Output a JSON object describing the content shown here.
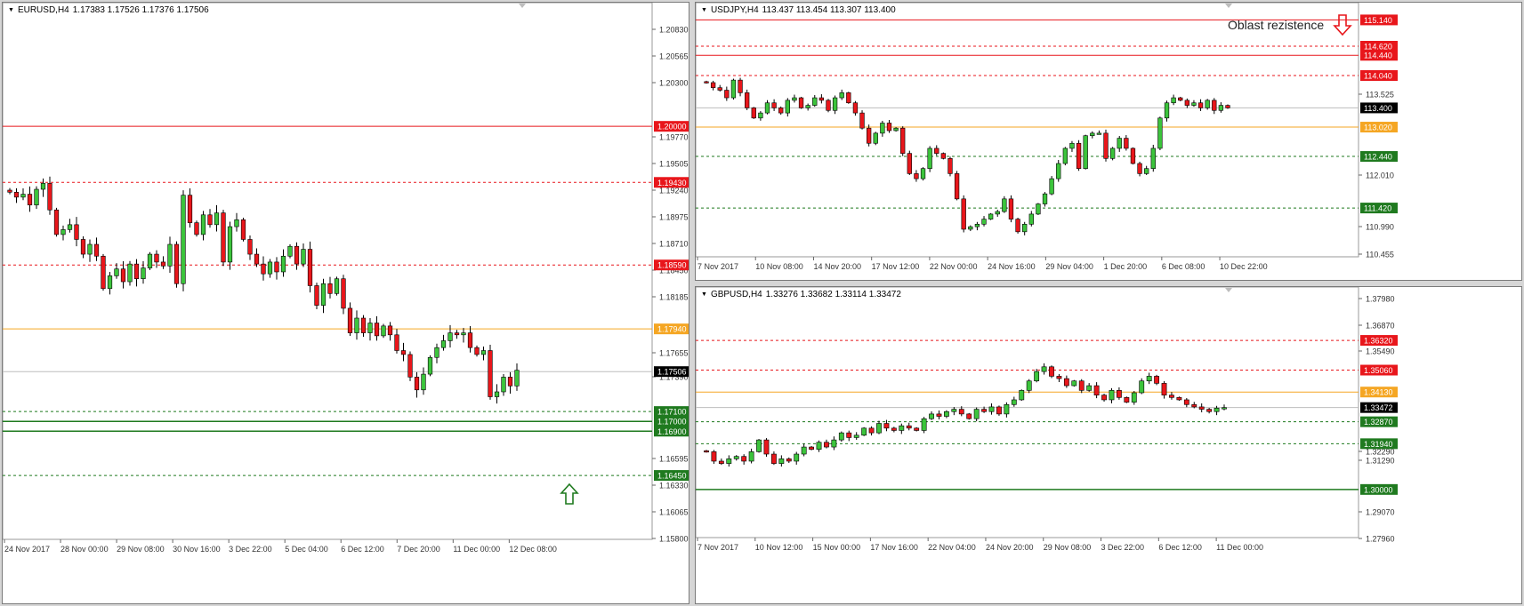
{
  "colors": {
    "background": "#ffffff",
    "resistance": "#e8161b",
    "support": "#1f7a1f",
    "pivot": "#f5a623",
    "current": "#000000",
    "bull": "#3cc43c",
    "bear": "#e8161b",
    "axis_text": "#333333"
  },
  "panels": [
    {
      "id": "eurusd",
      "header": {
        "symbol": "EURUSD,H4",
        "ohlc": "1.17383 1.17526 1.17376 1.17506"
      },
      "y_range": [
        1.158,
        1.21095
      ],
      "price_ticks": [
        "1.20830",
        "1.20565",
        "1.20300",
        "1.19770",
        "1.19505",
        "1.19240",
        "1.18975",
        "1.18710",
        "1.18450",
        "1.18185",
        "1.17655",
        "1.17390",
        "1.16595",
        "1.16330",
        "1.16065",
        "1.15800"
      ],
      "time_labels": [
        "24 Nov 2017",
        "28 Nov 00:00",
        "29 Nov 08:00",
        "30 Nov 16:00",
        "3 Dec 22:00",
        "5 Dec 04:00",
        "6 Dec 12:00",
        "7 Dec 20:00",
        "11 Dec 00:00",
        "12 Dec 08:00"
      ],
      "levels": [
        {
          "price": 1.2,
          "label": "1.20000",
          "kind": "resistance",
          "style": "solid"
        },
        {
          "price": 1.1943,
          "label": "1.19430",
          "kind": "resistance",
          "style": "dashed"
        },
        {
          "price": 1.1859,
          "label": "1.18590",
          "kind": "resistance",
          "style": "dashed"
        },
        {
          "price": 1.1794,
          "label": "1.17940",
          "kind": "pivot",
          "style": "solid"
        },
        {
          "price": 1.17506,
          "label": "1.17506",
          "kind": "current",
          "style": "solid"
        },
        {
          "price": 1.171,
          "label": "1.17100",
          "kind": "support",
          "style": "dashed"
        },
        {
          "price": 1.17,
          "label": "1.17000",
          "kind": "support",
          "style": "solid"
        },
        {
          "price": 1.169,
          "label": "1.16900",
          "kind": "support",
          "style": "solid"
        },
        {
          "price": 1.1645,
          "label": "1.16450",
          "kind": "support",
          "style": "dashed"
        }
      ],
      "candles": [
        1.1933,
        1.1928,
        1.1931,
        1.192,
        1.1936,
        1.1942,
        1.1915,
        1.189,
        1.1895,
        1.19,
        1.1885,
        1.187,
        1.188,
        1.1868,
        1.1835,
        1.1848,
        1.1855,
        1.1842,
        1.186,
        1.1845,
        1.1856,
        1.187,
        1.1862,
        1.1858,
        1.188,
        1.184,
        1.193,
        1.1902,
        1.189,
        1.191,
        1.19,
        1.1912,
        1.1862,
        1.1898,
        1.1905,
        1.1885,
        1.187,
        1.186,
        1.185,
        1.1862,
        1.1852,
        1.1868,
        1.1878,
        1.186,
        1.1875,
        1.1838,
        1.1818,
        1.184,
        1.183,
        1.1845,
        1.1815,
        1.179,
        1.1805,
        1.179,
        1.18,
        1.1787,
        1.1797,
        1.1788,
        1.1772,
        1.1768,
        1.1745,
        1.1732,
        1.1748,
        1.1765,
        1.1775,
        1.1782,
        1.179,
        1.1788,
        1.179,
        1.1775,
        1.1768,
        1.1772,
        1.1725,
        1.173,
        1.1745,
        1.1736,
        1.1752
      ]
    },
    {
      "id": "usdjpy",
      "header": {
        "symbol": "USDJPY,H4",
        "ohlc": "113.437 113.454 113.307 113.400"
      },
      "y_range": [
        110.455,
        115.2
      ],
      "price_ticks": [
        "113.525",
        "112.010",
        "110.990",
        "110.455"
      ],
      "time_labels": [
        "7 Nov 2017",
        "10 Nov 08:00",
        "14 Nov 20:00",
        "17 Nov 12:00",
        "22 Nov 00:00",
        "24 Nov 16:00",
        "29 Nov 04:00",
        "1 Dec 20:00",
        "6 Dec 08:00",
        "10 Dec 22:00"
      ],
      "levels": [
        {
          "price": 115.14,
          "label": "115.140",
          "kind": "resistance",
          "style": "solid"
        },
        {
          "price": 114.62,
          "label": "114.620",
          "kind": "resistance",
          "style": "dashed"
        },
        {
          "price": 114.44,
          "label": "114.440",
          "kind": "resistance",
          "style": "solid"
        },
        {
          "price": 114.04,
          "label": "114.040",
          "kind": "resistance",
          "style": "dashed"
        },
        {
          "price": 113.4,
          "label": "113.400",
          "kind": "current",
          "style": "solid"
        },
        {
          "price": 113.02,
          "label": "113.020",
          "kind": "pivot",
          "style": "solid"
        },
        {
          "price": 112.44,
          "label": "112.440",
          "kind": "support",
          "style": "dashed"
        },
        {
          "price": 111.42,
          "label": "111.420",
          "kind": "support",
          "style": "dashed"
        }
      ],
      "annotation": "Oblast rezistence",
      "candles": [
        113.9,
        113.8,
        113.75,
        113.6,
        113.95,
        113.7,
        113.4,
        113.2,
        113.3,
        113.5,
        113.4,
        113.3,
        113.55,
        113.6,
        113.4,
        113.45,
        113.6,
        113.55,
        113.35,
        113.6,
        113.7,
        113.5,
        113.3,
        113.0,
        112.7,
        112.9,
        113.1,
        112.95,
        113.0,
        112.5,
        112.1,
        112.0,
        112.2,
        112.6,
        112.5,
        112.4,
        112.1,
        111.6,
        111.0,
        111.05,
        111.1,
        111.2,
        111.3,
        111.35,
        111.6,
        111.2,
        110.95,
        111.1,
        111.3,
        111.5,
        111.7,
        112.0,
        112.3,
        112.6,
        112.7,
        112.2,
        112.85,
        112.9,
        112.9,
        112.4,
        112.6,
        112.8,
        112.6,
        112.3,
        112.1,
        112.2,
        112.6,
        113.2,
        113.5,
        113.6,
        113.55,
        113.45,
        113.5,
        113.4,
        113.55,
        113.35,
        113.45,
        113.4
      ]
    },
    {
      "id": "gbpusd",
      "header": {
        "symbol": "GBPUSD,H4",
        "ohlc": "1.33276 1.33682 1.33114 1.33472"
      },
      "y_range": [
        1.2796,
        1.3798
      ],
      "price_ticks": [
        "1.37980",
        "1.36870",
        "1.35490",
        "1.32290",
        "1.31290",
        "1.29070",
        "1.27960"
      ],
      "time_labels": [
        "7 Nov 2017",
        "10 Nov 12:00",
        "15 Nov 00:00",
        "17 Nov 16:00",
        "22 Nov 04:00",
        "24 Nov 20:00",
        "29 Nov 08:00",
        "3 Dec 22:00",
        "6 Dec 12:00",
        "11 Dec 00:00"
      ],
      "levels": [
        {
          "price": 1.3632,
          "label": "1.36320",
          "kind": "resistance",
          "style": "dashed"
        },
        {
          "price": 1.3506,
          "label": "1.35060",
          "kind": "resistance",
          "style": "dashed"
        },
        {
          "price": 1.3413,
          "label": "1.34130",
          "kind": "pivot",
          "style": "solid"
        },
        {
          "price": 1.33472,
          "label": "1.33472",
          "kind": "current",
          "style": "solid"
        },
        {
          "price": 1.3287,
          "label": "1.32870",
          "kind": "support",
          "style": "dashed"
        },
        {
          "price": 1.3194,
          "label": "1.31940",
          "kind": "support",
          "style": "dashed"
        },
        {
          "price": 1.3,
          "label": "1.30000",
          "kind": "support",
          "style": "solid"
        }
      ],
      "candles": [
        1.316,
        1.312,
        1.311,
        1.313,
        1.314,
        1.312,
        1.316,
        1.321,
        1.315,
        1.311,
        1.313,
        1.312,
        1.315,
        1.318,
        1.317,
        1.32,
        1.318,
        1.321,
        1.324,
        1.322,
        1.323,
        1.326,
        1.324,
        1.328,
        1.326,
        1.325,
        1.327,
        1.326,
        1.325,
        1.33,
        1.332,
        1.331,
        1.333,
        1.334,
        1.332,
        1.33,
        1.334,
        1.333,
        1.335,
        1.332,
        1.336,
        1.338,
        1.342,
        1.346,
        1.35,
        1.352,
        1.348,
        1.347,
        1.344,
        1.346,
        1.342,
        1.344,
        1.34,
        1.338,
        1.342,
        1.339,
        1.337,
        1.341,
        1.346,
        1.348,
        1.345,
        1.34,
        1.339,
        1.338,
        1.336,
        1.335,
        1.334,
        1.333,
        1.3345,
        1.3347
      ]
    }
  ]
}
